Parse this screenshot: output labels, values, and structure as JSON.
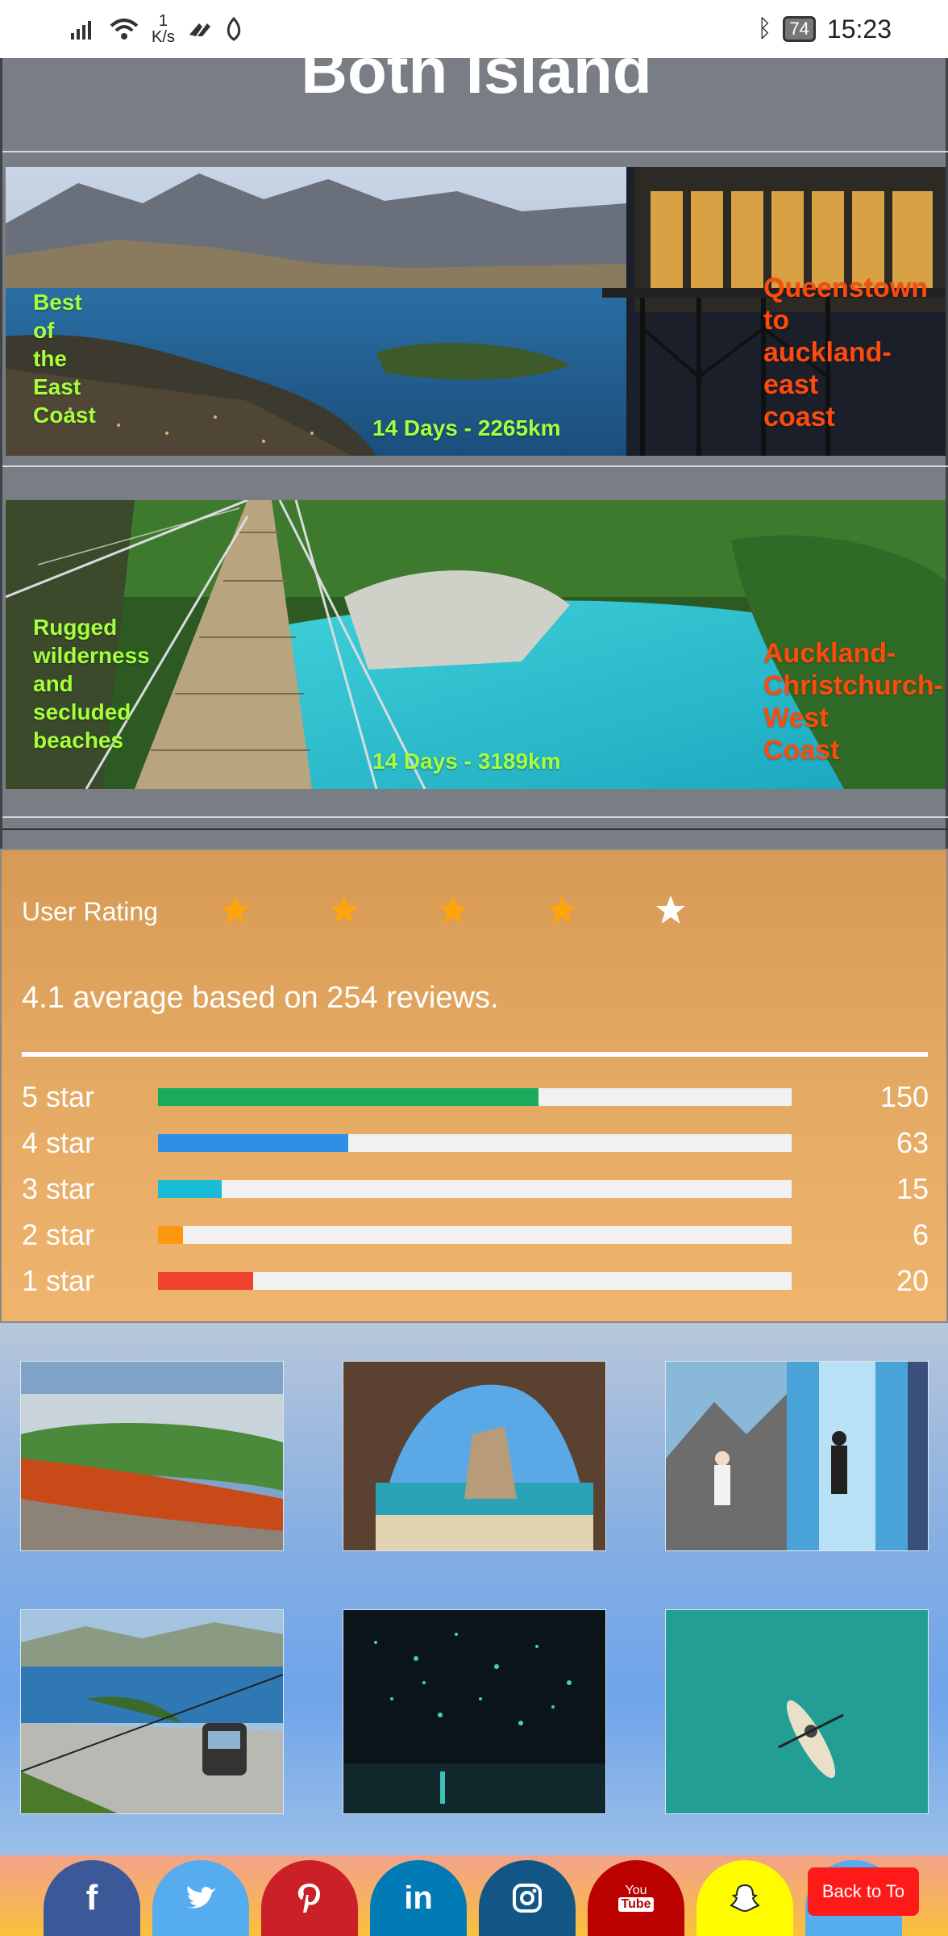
{
  "status_bar": {
    "net_speed_value": "1",
    "net_speed_unit": "K/s",
    "battery": "74",
    "time": "15:23"
  },
  "tours": {
    "section_title": "Both Island",
    "cards": [
      {
        "left_text": "Best of the East Coast",
        "left_lines": [
          "Best",
          "of",
          "the",
          "East",
          "Coast"
        ],
        "mid_text": "14 Days - 2265km",
        "right_lines": [
          "Queenstown",
          "to",
          "auckland-",
          "east",
          "coast"
        ]
      },
      {
        "left_text": "Rugged wilderness and secluded beaches",
        "left_lines": [
          "Rugged",
          "wilderness",
          "and",
          "secluded",
          "beaches"
        ],
        "mid_text": "14 Days - 3189km",
        "right_lines": [
          "Auckland-",
          "Christchurch-",
          "West",
          "Coast"
        ]
      }
    ]
  },
  "rating": {
    "label": "User Rating",
    "stars_filled": 4,
    "stars_total": 5,
    "average_text": "4.1 average based on 254 reviews.",
    "rows": [
      {
        "label": "5 star",
        "count": "150",
        "fraction": 0.6,
        "color": "#1aaa5c"
      },
      {
        "label": "4 star",
        "count": "63",
        "fraction": 0.3,
        "color": "#2f8fe6"
      },
      {
        "label": "3 star",
        "count": "15",
        "fraction": 0.1,
        "color": "#19bcd6"
      },
      {
        "label": "2 star",
        "count": "6",
        "fraction": 0.04,
        "color": "#ff980f"
      },
      {
        "label": "1 star",
        "count": "20",
        "fraction": 0.15,
        "color": "#f0412f"
      }
    ],
    "star_color_filled": "#ffa40a",
    "star_color_empty": "#ffffff"
  },
  "gallery": {
    "thumbnails": [
      "geothermal-pool",
      "cathedral-cove-arch",
      "glacier-ice-cave",
      "queenstown-gondola",
      "glowworm-cave",
      "kayak-turquoise-water"
    ]
  },
  "social": {
    "icons": [
      {
        "name": "facebook-icon",
        "glyph": "f",
        "color": "#3b5998"
      },
      {
        "name": "twitter-icon",
        "glyph": "🐦",
        "color": "#55acee"
      },
      {
        "name": "pinterest-icon",
        "glyph": "P",
        "color": "#cb2027"
      },
      {
        "name": "linkedin-icon",
        "glyph": "in",
        "color": "#007bb5"
      },
      {
        "name": "instagram-icon",
        "glyph": "◎",
        "color": "#125688"
      },
      {
        "name": "youtube-icon",
        "glyph": "You Tube",
        "color": "#bb0000"
      },
      {
        "name": "snapchat-icon",
        "glyph": "👻",
        "color": "#fffc00"
      }
    ],
    "back_to_top": "Back to To"
  }
}
